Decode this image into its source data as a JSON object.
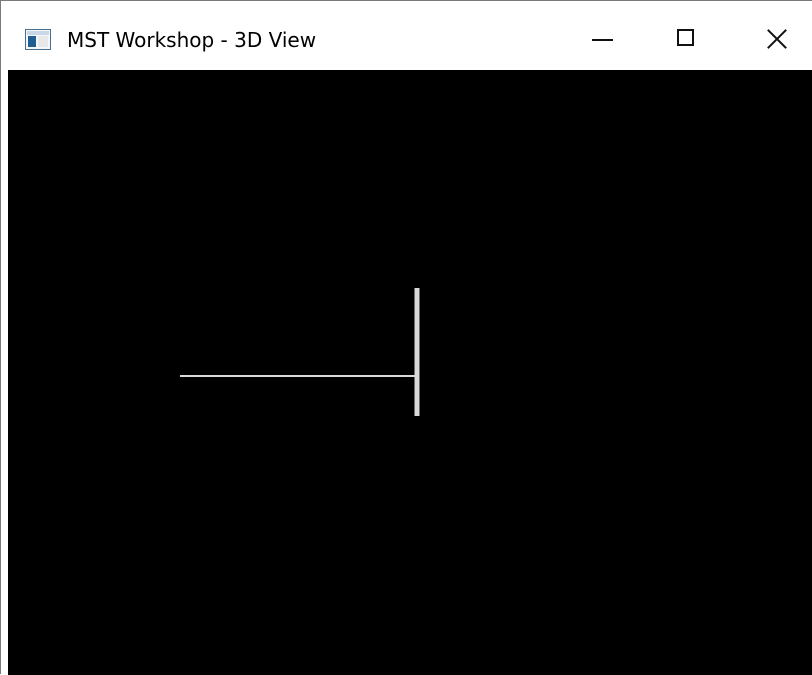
{
  "window": {
    "title": "MST Workshop - 3D View",
    "controls": {
      "minimize": "minimize",
      "maximize": "maximize",
      "close": "close"
    }
  },
  "viewport": {
    "background": "#000000",
    "stroke_color": "#d9d9d9"
  }
}
